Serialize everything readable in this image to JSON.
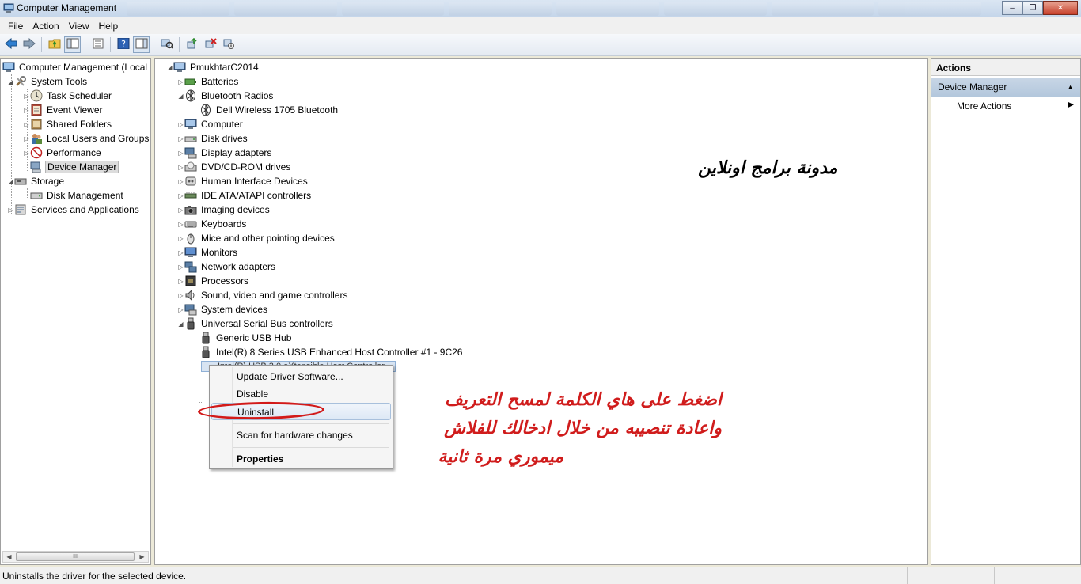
{
  "window": {
    "title": "Computer Management"
  },
  "menu": [
    "File",
    "Action",
    "View",
    "Help"
  ],
  "left_tree": {
    "root": "Computer Management (Local",
    "items": [
      {
        "label": "System Tools",
        "level": 1,
        "expander": "open",
        "icon": "tools-icon"
      },
      {
        "label": "Task Scheduler",
        "level": 2,
        "expander": "closed",
        "icon": "clock-icon"
      },
      {
        "label": "Event Viewer",
        "level": 2,
        "expander": "closed",
        "icon": "event-viewer-icon"
      },
      {
        "label": "Shared Folders",
        "level": 2,
        "expander": "closed",
        "icon": "shared-folder-icon"
      },
      {
        "label": "Local Users and Groups",
        "level": 2,
        "expander": "closed",
        "icon": "users-icon"
      },
      {
        "label": "Performance",
        "level": 2,
        "expander": "closed",
        "icon": "performance-icon"
      },
      {
        "label": "Device Manager",
        "level": 2,
        "expander": "none",
        "icon": "device-manager-icon",
        "selected": true
      },
      {
        "label": "Storage",
        "level": 1,
        "expander": "open",
        "icon": "storage-icon"
      },
      {
        "label": "Disk Management",
        "level": 2,
        "expander": "none",
        "icon": "disk-icon"
      },
      {
        "label": "Services and Applications",
        "level": 1,
        "expander": "closed",
        "icon": "services-icon"
      }
    ]
  },
  "device_tree": {
    "root": "PmukhtarC2014",
    "items": [
      {
        "label": "Batteries",
        "level": 1,
        "expander": "closed",
        "icon": "battery-icon"
      },
      {
        "label": "Bluetooth Radios",
        "level": 1,
        "expander": "open",
        "icon": "bluetooth-icon"
      },
      {
        "label": "Dell Wireless 1705 Bluetooth",
        "level": 2,
        "expander": "none",
        "icon": "bluetooth-icon"
      },
      {
        "label": "Computer",
        "level": 1,
        "expander": "closed",
        "icon": "computer-icon"
      },
      {
        "label": "Disk drives",
        "level": 1,
        "expander": "closed",
        "icon": "disk-drive-icon"
      },
      {
        "label": "Display adapters",
        "level": 1,
        "expander": "closed",
        "icon": "display-adapter-icon"
      },
      {
        "label": "DVD/CD-ROM drives",
        "level": 1,
        "expander": "closed",
        "icon": "dvd-icon"
      },
      {
        "label": "Human Interface Devices",
        "level": 1,
        "expander": "closed",
        "icon": "hid-icon"
      },
      {
        "label": "IDE ATA/ATAPI controllers",
        "level": 1,
        "expander": "closed",
        "icon": "ide-controller-icon"
      },
      {
        "label": "Imaging devices",
        "level": 1,
        "expander": "closed",
        "icon": "camera-icon"
      },
      {
        "label": "Keyboards",
        "level": 1,
        "expander": "closed",
        "icon": "keyboard-icon"
      },
      {
        "label": "Mice and other pointing devices",
        "level": 1,
        "expander": "closed",
        "icon": "mouse-icon"
      },
      {
        "label": "Monitors",
        "level": 1,
        "expander": "closed",
        "icon": "monitor-icon"
      },
      {
        "label": "Network adapters",
        "level": 1,
        "expander": "closed",
        "icon": "network-icon"
      },
      {
        "label": "Processors",
        "level": 1,
        "expander": "closed",
        "icon": "processor-icon"
      },
      {
        "label": "Sound, video and game controllers",
        "level": 1,
        "expander": "closed",
        "icon": "sound-icon"
      },
      {
        "label": "System devices",
        "level": 1,
        "expander": "closed",
        "icon": "system-devices-icon"
      },
      {
        "label": "Universal Serial Bus controllers",
        "level": 1,
        "expander": "open",
        "icon": "usb-icon"
      },
      {
        "label": "Generic USB Hub",
        "level": 2,
        "expander": "none",
        "icon": "usb-icon"
      },
      {
        "label": "Intel(R) 8 Series USB Enhanced Host Controller #1 - 9C26",
        "level": 2,
        "expander": "none",
        "icon": "usb-icon"
      }
    ],
    "selected_partial": "Intel(R) USB 3.0 eXtensible Host Controller"
  },
  "context_menu": {
    "items": [
      {
        "label": "Update Driver Software...",
        "bold": false,
        "hover": false
      },
      {
        "label": "Disable",
        "bold": false,
        "hover": false
      },
      {
        "label": "Uninstall",
        "bold": false,
        "hover": true
      },
      {
        "label": "Scan for hardware changes",
        "bold": false,
        "hover": false
      },
      {
        "label": "Properties",
        "bold": true,
        "hover": false
      }
    ]
  },
  "actions": {
    "header": "Actions",
    "section": "Device Manager",
    "item": "More Actions"
  },
  "annotations": {
    "blog_name": "مدونة برامج اونلاين",
    "instruction_line1": "اضغط على هاي الكلمة لمسح التعريف",
    "instruction_line2": "واعادة تنصيبه من خلال ادخالك للفلاش",
    "instruction_line3": "ميموري  مرة ثانية",
    "highlight_color": "#d21a1a"
  },
  "status": {
    "text": "Uninstalls the driver for the selected device."
  },
  "window_controls": [
    "–",
    "❐",
    "✕"
  ],
  "scrollbar": {
    "thumb_grip": "III"
  },
  "colors": {
    "title_gradient_top": "#dbe6f3",
    "actions_section": "#b3c7dc",
    "menu_hover": "#dde8f5"
  }
}
